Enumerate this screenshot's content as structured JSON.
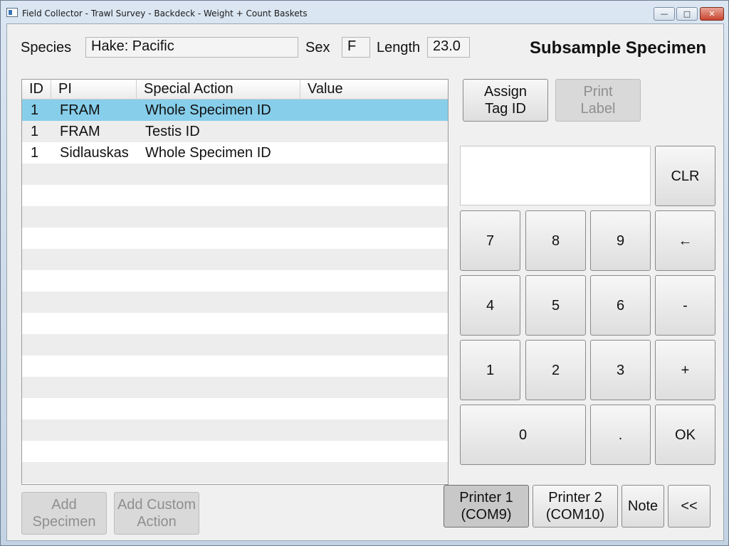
{
  "window": {
    "title": "Field Collector - Trawl Survey - Backdeck - Weight + Count Baskets",
    "controls": {
      "minimize": "—",
      "maximize": "□",
      "close": "✕"
    }
  },
  "header": {
    "species_label": "Species",
    "species_value": "Hake: Pacific",
    "sex_label": "Sex",
    "sex_value": "F",
    "length_label": "Length",
    "length_value": "23.0",
    "title": "Subsample Specimen"
  },
  "grid": {
    "columns": [
      "ID",
      "PI",
      "Special Action",
      "Value"
    ],
    "rows": [
      {
        "id": "1",
        "pi": "FRAM",
        "action": "Whole Specimen ID",
        "value": ""
      },
      {
        "id": "1",
        "pi": "FRAM",
        "action": "Testis ID",
        "value": ""
      },
      {
        "id": "1",
        "pi": "Sidlauskas",
        "action": "Whole Specimen ID",
        "value": ""
      },
      {
        "id": "",
        "pi": "",
        "action": "",
        "value": ""
      },
      {
        "id": "",
        "pi": "",
        "action": "",
        "value": ""
      },
      {
        "id": "",
        "pi": "",
        "action": "",
        "value": ""
      },
      {
        "id": "",
        "pi": "",
        "action": "",
        "value": ""
      },
      {
        "id": "",
        "pi": "",
        "action": "",
        "value": ""
      },
      {
        "id": "",
        "pi": "",
        "action": "",
        "value": ""
      },
      {
        "id": "",
        "pi": "",
        "action": "",
        "value": ""
      },
      {
        "id": "",
        "pi": "",
        "action": "",
        "value": ""
      },
      {
        "id": "",
        "pi": "",
        "action": "",
        "value": ""
      },
      {
        "id": "",
        "pi": "",
        "action": "",
        "value": ""
      },
      {
        "id": "",
        "pi": "",
        "action": "",
        "value": ""
      },
      {
        "id": "",
        "pi": "",
        "action": "",
        "value": ""
      },
      {
        "id": "",
        "pi": "",
        "action": "",
        "value": ""
      },
      {
        "id": "",
        "pi": "",
        "action": "",
        "value": ""
      },
      {
        "id": "",
        "pi": "",
        "action": "",
        "value": ""
      }
    ],
    "selected_row": 0
  },
  "actions": {
    "assign_tag": "Assign\nTag ID",
    "print_label": "Print\nLabel",
    "add_specimen": "Add\nSpecimen",
    "add_custom_action": "Add Custom\nAction"
  },
  "keypad": {
    "entry_value": "",
    "clr": "CLR",
    "k7": "7",
    "k8": "8",
    "k9": "9",
    "backspace": "←",
    "k4": "4",
    "k5": "5",
    "k6": "6",
    "minus": "-",
    "k1": "1",
    "k2": "2",
    "k3": "3",
    "plus": "+",
    "k0": "0",
    "dot": ".",
    "ok": "OK"
  },
  "footer": {
    "printer1": "Printer 1\n(COM9)",
    "printer2": "Printer 2\n(COM10)",
    "note": "Note",
    "back": "<<"
  },
  "colors": {
    "selected_row": "#87ceeb"
  }
}
